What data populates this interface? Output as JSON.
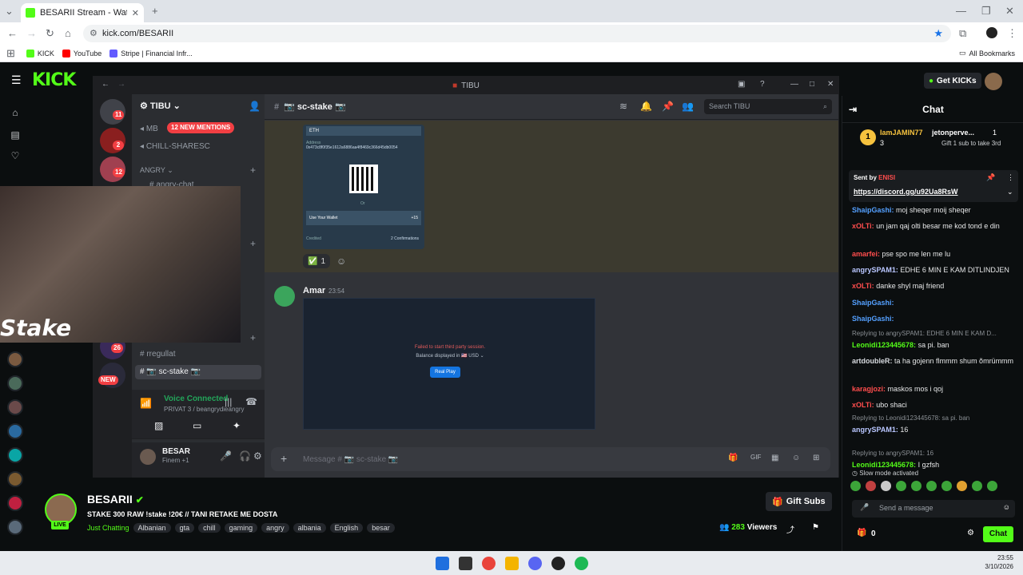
{
  "browser": {
    "tab_title": "BESARII Stream - Watch Live o",
    "url": "kick.com/BESARII",
    "bookmarks": [
      {
        "label": "KICK"
      },
      {
        "label": "YouTube"
      },
      {
        "label": "Stripe | Financial Infr..."
      }
    ],
    "all_bookmarks": "All Bookmarks"
  },
  "kick": {
    "logo": "KICK",
    "get_kicks": "Get KICKs"
  },
  "discord": {
    "window_title": "TIBU",
    "server_name": "TIBU",
    "mentions_label": "12 NEW MENTIONS",
    "channels": [
      {
        "name": "MB"
      },
      {
        "name": "CHILL-SHARESC"
      },
      {
        "name": "ANGRY"
      },
      {
        "name": "angry-chat"
      },
      {
        "name": "rregullat"
      },
      {
        "name": "📷 sc-stake 📷"
      }
    ],
    "channel_name": "📷 sc-stake 📷",
    "search_placeholder": "Search TIBU",
    "server_badges": [
      "11",
      "2",
      "12",
      "26",
      "NEW"
    ],
    "crypto_card": {
      "currency": "ETH",
      "address_label": "Address",
      "address": "0x473c8f0f35e1612a6886aa4f8469c366d45db0054",
      "or": "Or",
      "wallet_label": "Use Your Wallet",
      "wallet_extra": "+15",
      "credited": "Credited",
      "confirmations": "2 Confirmations"
    },
    "reaction_count": "1",
    "message": {
      "author": "Amar",
      "time": "23:54",
      "error_text": "Failed to start third party session.",
      "balance_text": "Balance displayed in 🇺🇸 USD ⌄",
      "play_label": "Real Play"
    },
    "composer_placeholder": "Message # 📷 sc-stake 📷",
    "voice": {
      "status": "Voice Connected",
      "channel": "PRIVAT 3 / beangrydieangry"
    },
    "user": {
      "name": "BESAR",
      "status": "Finem +1"
    }
  },
  "overlay": {
    "stake_logo": "Stake"
  },
  "stream": {
    "streamer": "BESARII",
    "title": "STAKE 300 RAW !stake !20€ // TANI RETAKE ME DOSTA",
    "live": "LIVE",
    "category": "Just Chatting",
    "tags": [
      "Albanian",
      "gta",
      "chill",
      "gaming",
      "angry",
      "albania",
      "English",
      "besar"
    ],
    "gift_subs": "Gift Subs",
    "viewers": "283",
    "viewers_label": "Viewers"
  },
  "chat": {
    "title": "Chat",
    "top_gifter_1": "IamJAMIN77",
    "top_gifter_1_count": "3",
    "top_gifter_2": "jetonperve...",
    "top_gifter_2_count": "1",
    "gift_prompt": "Gift 1 sub to take 3rd",
    "pinned_sender_label": "Sent by",
    "pinned_sender": "ENISI",
    "pinned_link": "https://discord.gg/u92Ua8RsW",
    "messages": [
      {
        "user": "ShaipGashi:",
        "text": "moj sheqer moij sheqer",
        "color": "#54a0ff"
      },
      {
        "user": "xOLTi:",
        "text": "un jam qaj olti besar me kod tond e din",
        "color": "#ff4d4d"
      },
      {
        "user": "amarfei:",
        "text": "pse spo me len me lu",
        "color": "#ff4d4d"
      },
      {
        "user": "angrySPAM1:",
        "text": "EDHE 6 MIN E KAM DITLINDJEN",
        "color": "#b9c6ff"
      },
      {
        "user": "xOLTi:",
        "text": "danke shyl maj friend",
        "color": "#ff4d4d"
      },
      {
        "user": "ShaipGashi:",
        "text": "",
        "color": "#54a0ff"
      },
      {
        "user": "ShaipGashi:",
        "text": "",
        "color": "#54a0ff"
      },
      {
        "user": "Leonidi123445678:",
        "text": "sa pi. ban",
        "color": "#53fc18",
        "reply": "Replying to angrySPAM1: EDHE 6 MIN E KAM D..."
      },
      {
        "user": "artdoubleR:",
        "text": "ta ha gojenn flmmm shum õmrümmm",
        "color": "#d8dbe0"
      },
      {
        "user": "karagjozi:",
        "text": "maskos mos i qoj",
        "color": "#ff4d4d"
      },
      {
        "user": "xOLTi:",
        "text": "ubo shaci",
        "color": "#ff4d4d"
      },
      {
        "user": "angrySPAM1:",
        "text": "16",
        "color": "#b9c6ff",
        "reply": "Replying to Leonidi123445678: sa pi. ban"
      },
      {
        "user": "Leonidi123445678:",
        "text": "I gzfsh",
        "color": "#53fc18",
        "reply": "Replying to angrySPAM1: 16"
      }
    ],
    "slow_mode": "Slow mode activated",
    "send_placeholder": "Send a message",
    "points": "0",
    "chat_button": "Chat"
  },
  "taskbar": {
    "time": "23:55",
    "date": "3/10/2026"
  }
}
